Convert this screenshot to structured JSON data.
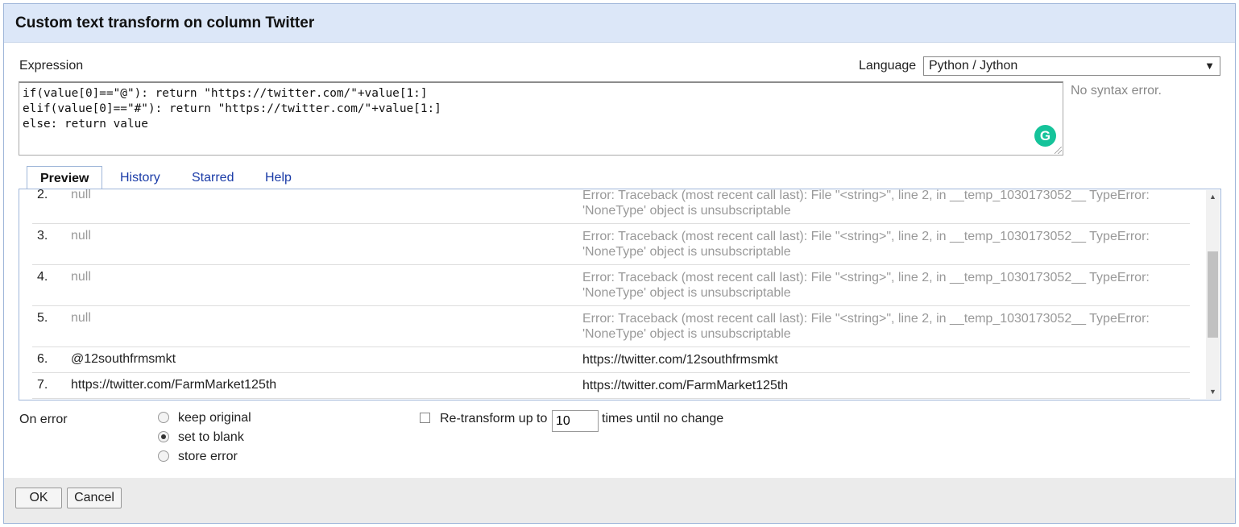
{
  "dialog": {
    "title": "Custom text transform on column Twitter"
  },
  "expression": {
    "label": "Expression",
    "language_label": "Language",
    "language_value": "Python / Jython",
    "code": "if(value[0]==\"@\"): return \"https://twitter.com/\"+value[1:]\nelif(value[0]==\"#\"): return \"https://twitter.com/\"+value[1:]\nelse: return value",
    "syntax_status": "No syntax error."
  },
  "tabs": [
    {
      "label": "Preview",
      "active": true
    },
    {
      "label": "History",
      "active": false
    },
    {
      "label": "Starred",
      "active": false
    },
    {
      "label": "Help",
      "active": false
    }
  ],
  "preview": {
    "rows": [
      {
        "num": "2.",
        "original": "null",
        "result": "Error: Traceback (most recent call last): File \"<string>\", line 2, in __temp_1030173052__ TypeError: 'NoneType' object is unsubscriptable",
        "error": true
      },
      {
        "num": "3.",
        "original": "null",
        "result": "Error: Traceback (most recent call last): File \"<string>\", line 2, in __temp_1030173052__ TypeError: 'NoneType' object is unsubscriptable",
        "error": true
      },
      {
        "num": "4.",
        "original": "null",
        "result": "Error: Traceback (most recent call last): File \"<string>\", line 2, in __temp_1030173052__ TypeError: 'NoneType' object is unsubscriptable",
        "error": true
      },
      {
        "num": "5.",
        "original": "null",
        "result": "Error: Traceback (most recent call last): File \"<string>\", line 2, in __temp_1030173052__ TypeError: 'NoneType' object is unsubscriptable",
        "error": true
      },
      {
        "num": "6.",
        "original": "@12southfrmsmkt",
        "result": "https://twitter.com/12southfrmsmkt",
        "error": false
      },
      {
        "num": "7.",
        "original": "https://twitter.com/FarmMarket125th",
        "result": "https://twitter.com/FarmMarket125th",
        "error": false
      }
    ]
  },
  "on_error": {
    "label": "On error",
    "options": [
      {
        "label": "keep original",
        "checked": false
      },
      {
        "label": "set to blank",
        "checked": true
      },
      {
        "label": "store error",
        "checked": false
      }
    ]
  },
  "retransform": {
    "checked": false,
    "label_before": "Re-transform up to",
    "value": "10",
    "label_after": "times until no change"
  },
  "footer": {
    "ok_label": "OK",
    "cancel_label": "Cancel"
  }
}
